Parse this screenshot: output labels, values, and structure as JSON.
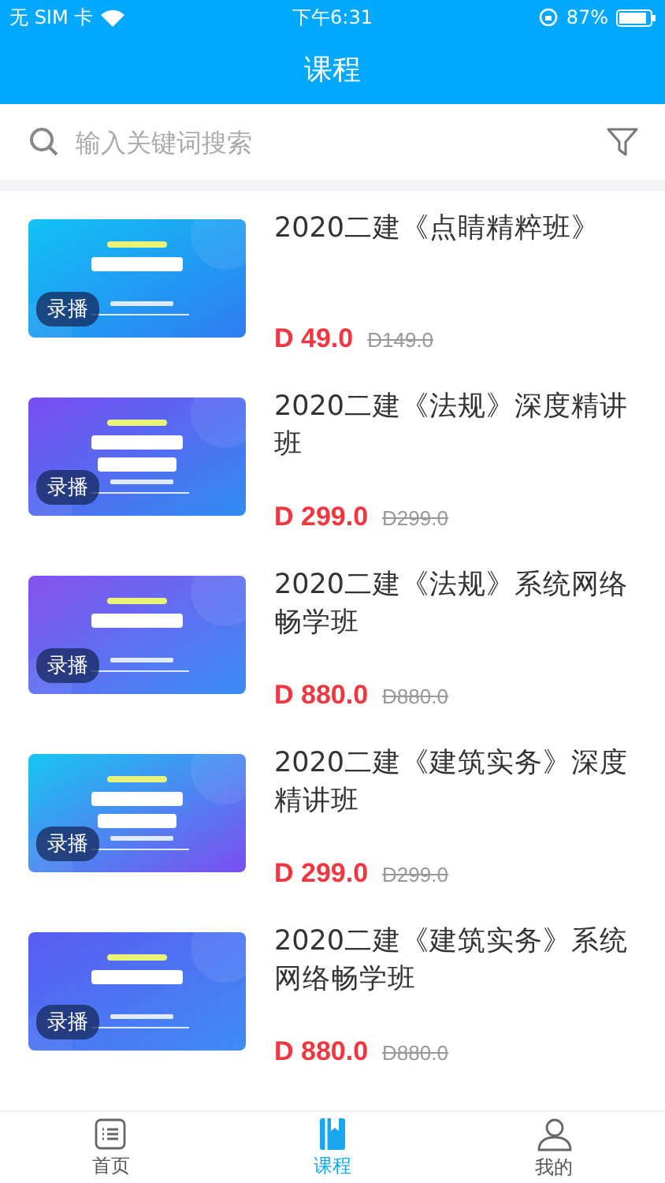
{
  "status_bar": {
    "carrier": "无 SIM 卡",
    "time": "下午6:31",
    "battery": "87%"
  },
  "nav": {
    "title": "课程"
  },
  "search": {
    "placeholder": "输入关键词搜索"
  },
  "courses": [
    {
      "badge": "录播",
      "title": "2020二建《点睛精粹班》",
      "price": "D 49.0",
      "original_price": "D149.0"
    },
    {
      "badge": "录播",
      "title": "2020二建《法规》深度精讲班",
      "price": "D 299.0",
      "original_price": "D299.0"
    },
    {
      "badge": "录播",
      "title": "2020二建《法规》系统网络畅学班",
      "price": "D 880.0",
      "original_price": "D880.0"
    },
    {
      "badge": "录播",
      "title": "2020二建《建筑实务》深度精讲班",
      "price": "D 299.0",
      "original_price": "D299.0"
    },
    {
      "badge": "录播",
      "title": "2020二建《建筑实务》系统网络畅学班",
      "price": "D 880.0",
      "original_price": "D880.0"
    }
  ],
  "tab_bar": [
    {
      "kind": "home",
      "label": "首页",
      "selected": false
    },
    {
      "kind": "course",
      "label": "课程",
      "selected": true
    },
    {
      "kind": "me",
      "label": "我的",
      "selected": false
    }
  ]
}
